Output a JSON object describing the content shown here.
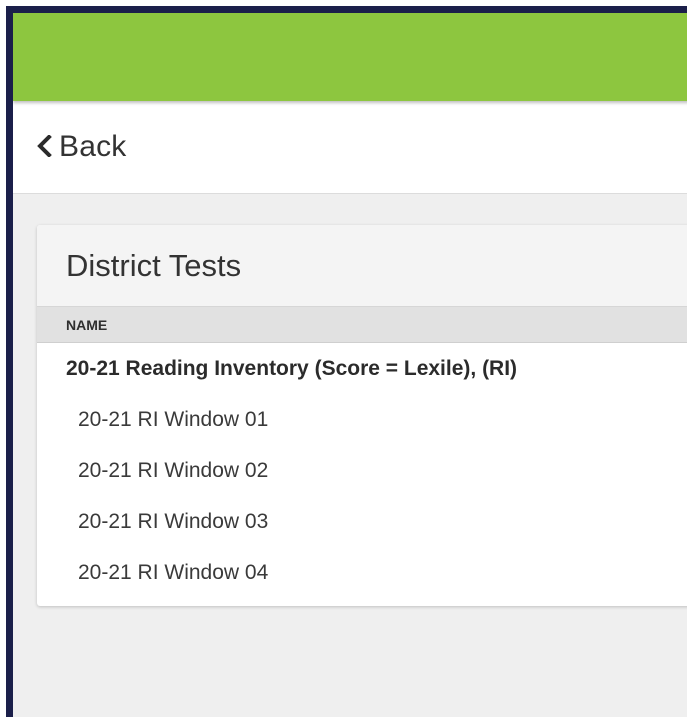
{
  "header": {
    "color": "#8dc63f"
  },
  "nav": {
    "back_label": "Back",
    "back_icon": "chevron-left-icon"
  },
  "district_tests": {
    "title": "District Tests",
    "column_header": "NAME",
    "group": {
      "label": "20-21 Reading Inventory (Score = Lexile), (RI)",
      "items": [
        {
          "label": "20-21 RI Window 01"
        },
        {
          "label": "20-21 RI Window 02"
        },
        {
          "label": "20-21 RI Window 03"
        },
        {
          "label": "20-21 RI Window 04"
        }
      ]
    }
  }
}
